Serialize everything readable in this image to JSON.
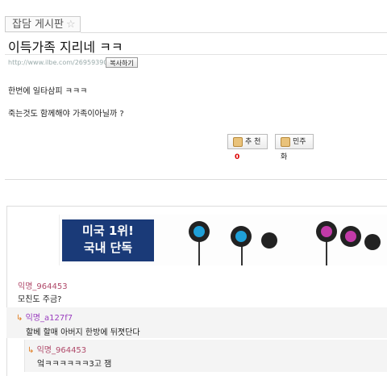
{
  "board": {
    "name": "잡담 게시판",
    "star": "☆"
  },
  "post": {
    "title": "이득가족 지리네 ㅋㅋ",
    "url": "http://www.ilbe.com/2695939060",
    "copy_label": "복사하기",
    "lines": [
      "한번에 일타삼피 ㅋㅋㅋ",
      "죽는것도 함께해야 가족이아닐까 ?"
    ],
    "vote_up_label": "추 천",
    "vote_up_count": "0",
    "vote_down_label": "민주화"
  },
  "ad": {
    "line1": "미국 1위!",
    "line2": "국내 단독"
  },
  "comments": [
    {
      "author": "익명_964453",
      "text": "모친도 주금?"
    },
    {
      "author": "익명_a127f7",
      "text": "할베 할매 아버지 한방에 뒤졋단다",
      "reply": true
    },
    {
      "author": "익명_964453",
      "text": "엌ㅋㅋㅋㅋㅋㅋ3고 잼",
      "reply": true
    }
  ],
  "icons": {
    "reply_arrow": "↳"
  }
}
